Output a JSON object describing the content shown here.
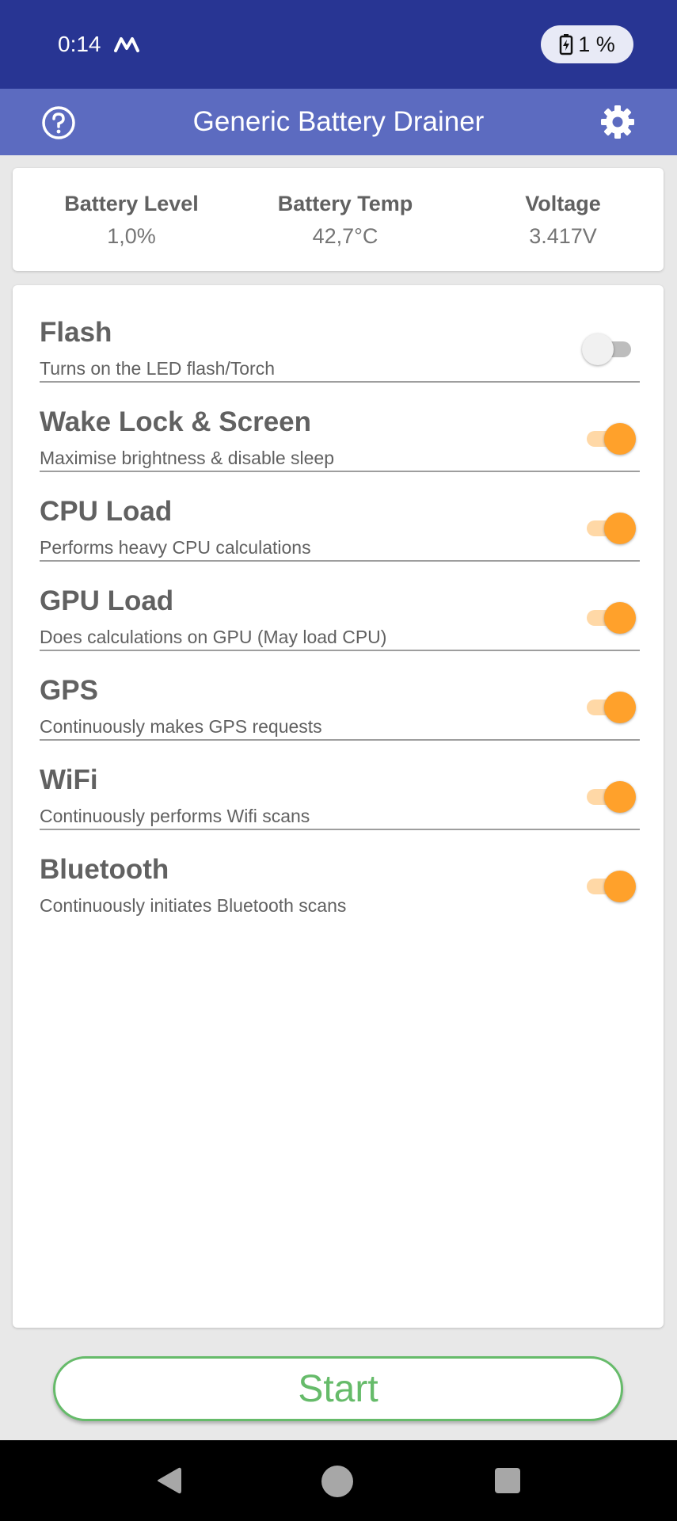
{
  "status_bar": {
    "time": "0:14",
    "battery_percent": "1 %",
    "background": "#283593"
  },
  "app_bar": {
    "title": "Generic Battery Drainer",
    "background": "#5c6bc0"
  },
  "stats": [
    {
      "label": "Battery Level",
      "value": "1,0%"
    },
    {
      "label": "Battery Temp",
      "value": "42,7°C"
    },
    {
      "label": "Voltage",
      "value": "3.417V"
    }
  ],
  "options": [
    {
      "title": "Flash",
      "description": "Turns on the LED flash/Torch",
      "enabled": false
    },
    {
      "title": "Wake Lock & Screen",
      "description": "Maximise brightness & disable sleep",
      "enabled": true
    },
    {
      "title": "CPU Load",
      "description": "Performs heavy CPU calculations",
      "enabled": true
    },
    {
      "title": "GPU Load",
      "description": "Does calculations on GPU (May load CPU)",
      "enabled": true
    },
    {
      "title": "GPS",
      "description": "Continuously makes GPS requests",
      "enabled": true
    },
    {
      "title": "WiFi",
      "description": "Continuously performs Wifi scans",
      "enabled": true
    },
    {
      "title": "Bluetooth",
      "description": "Continuously initiates Bluetooth scans",
      "enabled": true
    }
  ],
  "start_button": {
    "label": "Start",
    "color": "#66bb6a"
  },
  "colors": {
    "accent": "#ffa12b",
    "accent_track": "#ffd8a6"
  },
  "icons": {
    "help": "help-circle-icon",
    "settings": "gear-icon",
    "status_app": "notification-app-icon",
    "battery": "battery-charging-icon",
    "nav_back": "back-triangle-icon",
    "nav_home": "home-circle-icon",
    "nav_recent": "recent-square-icon"
  }
}
